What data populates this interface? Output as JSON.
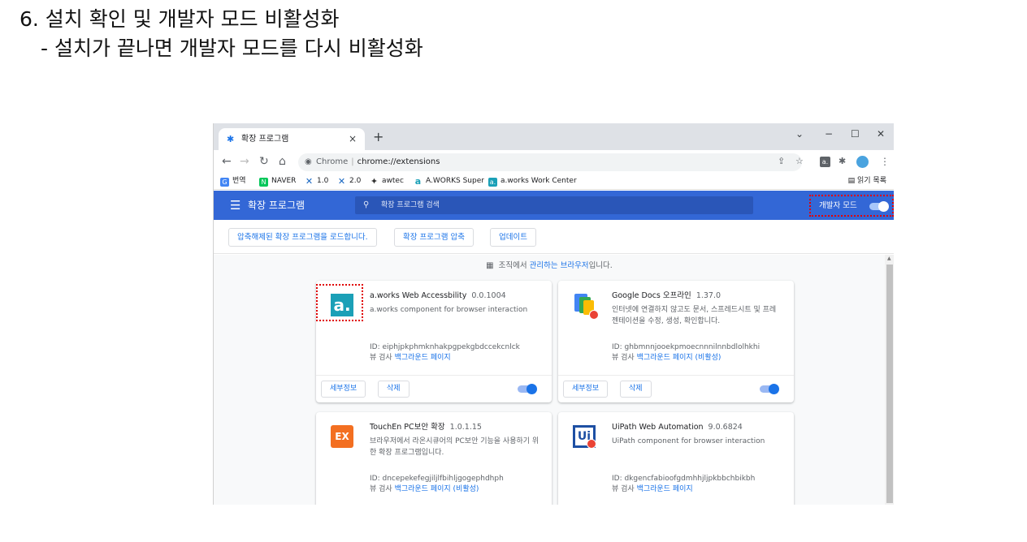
{
  "slide": {
    "title": "6. 설치 확인 및 개발자 모드 비활성화",
    "subtitle": "- 설치가 끝나면 개발자 모드를 다시 비활성화"
  },
  "browser": {
    "tab_title": "확장 프로그램",
    "tab_close": "×",
    "new_tab": "+",
    "win_chevron": "⌄",
    "win_min": "−",
    "win_max": "☐",
    "win_close": "✕",
    "omnibox_site": "Chrome",
    "omnibox_url": "chrome://extensions",
    "bookmarks": [
      {
        "label": "번역",
        "color": "#4285f4",
        "glyph": "G"
      },
      {
        "label": "NAVER",
        "color": "#03c75a",
        "glyph": "N"
      },
      {
        "label": "1.0",
        "color": "#1565c0",
        "glyph": "✕"
      },
      {
        "label": "2.0",
        "color": "#1565c0",
        "glyph": "✕"
      },
      {
        "label": "awtec",
        "color": "#333333",
        "glyph": "✦"
      },
      {
        "label": "A.WORKS Super",
        "color": "#1ba0b7",
        "glyph": "a"
      },
      {
        "label": "a.works Work Center",
        "color": "#1ba0b7",
        "glyph": "a."
      }
    ],
    "reading_list": "읽기 목록"
  },
  "extensions": {
    "header_title": "확장 프로그램",
    "search_placeholder": "확장 프로그램 검색",
    "dev_mode_label": "개발자 모드",
    "dev_mode_on": true,
    "actions": {
      "load_unpacked": "압축해제된 확장 프로그램을 로드합니다.",
      "pack": "확장 프로그램 압축",
      "update": "업데이트"
    },
    "managed_prefix": "조직에서 ",
    "managed_link": "관리하는 브라우저",
    "managed_suffix": "입니다.",
    "cards": [
      {
        "name": "a.works Web Accessbility",
        "version": "0.0.1004",
        "desc": "a.works component for browser interaction",
        "id": "ID: eiphjpkphmknhakpgpekgbdccekcnlck",
        "views_label": "뷰 검사 ",
        "views_link": "백그라운드 페이지",
        "details": "세부정보",
        "remove": "삭제",
        "enabled": true
      },
      {
        "name": "Google Docs 오프라인",
        "version": "1.37.0",
        "desc": "인터넷에 연결하지 않고도 문서, 스프레드시트 및 프레젠테이션을 수정, 생성, 확인합니다.",
        "id": "ID: ghbmnnjooekpmoecnnnilnnbdlolhkhi",
        "views_label": "뷰 검사 ",
        "views_link": "백그라운드 페이지 (비활성)",
        "details": "세부정보",
        "remove": "삭제",
        "enabled": true
      },
      {
        "name": "TouchEn PC보안 확장",
        "version": "1.0.1.15",
        "desc": "브라우저에서 라온시큐어의 PC보안 기능을 사용하기 위한 확장 프로그램입니다.",
        "id": "ID: dncepekefegjiljlfbihljgogephdhph",
        "views_label": "뷰 검사 ",
        "views_link": "백그라운드 페이지 (비활성)"
      },
      {
        "name": "UiPath Web Automation",
        "version": "9.0.6824",
        "desc": "UiPath component for browser interaction",
        "id": "ID: dkgencfabioofgdmhhjljpkbbchbikbh",
        "views_label": "뷰 검사 ",
        "views_link": "백그라운드 페이지"
      }
    ]
  },
  "colors": {
    "header_blue": "#3367d6",
    "link_blue": "#1a73e8",
    "highlight_red": "#e00000"
  }
}
